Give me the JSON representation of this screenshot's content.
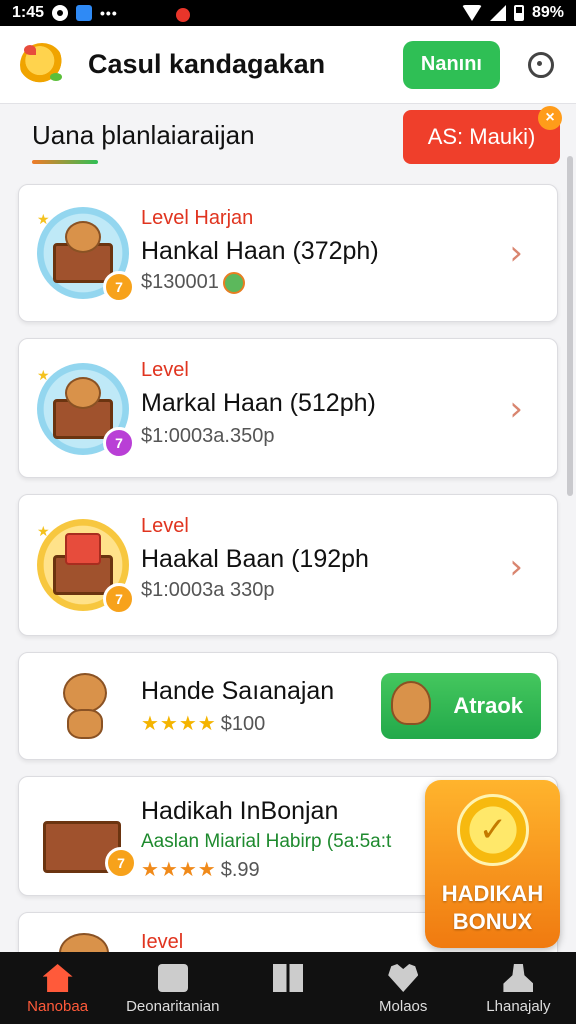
{
  "status_bar": {
    "time": "1:45",
    "battery": "89%"
  },
  "header": {
    "title": "Casul kandagakan",
    "primary_button": "Nanını"
  },
  "section": {
    "title": "Uana þlanlaiaraijan",
    "promo_button": "AS: Mauki)",
    "promo_close": "×"
  },
  "cards": [
    {
      "level": "Level Harjan",
      "title": "Hankal Haan (372ph)",
      "price": "$130001",
      "badge": "7"
    },
    {
      "level": "Level",
      "title": "Markal Haan (512ph)",
      "price": "$1:0003a.350p",
      "badge": "7"
    },
    {
      "level": "Level",
      "title": "Haakal Baan (192ph",
      "price": "$1:0003a 330p",
      "badge": "7"
    }
  ],
  "featured": {
    "title": "Hande Saıanajan",
    "stars": "★★★★",
    "price": "$100",
    "button": "Atraok"
  },
  "bundle": {
    "title": "Hadikah InBonjan",
    "subtitle": "Aaslan Miarial Habirp (5a:5a:t",
    "stars": "★★★★",
    "price": "$.99",
    "badge": "7"
  },
  "partial_card": {
    "level": "Ievel"
  },
  "bonus": {
    "line1": "HADIKAH",
    "line2": "BONUX"
  },
  "bottom_nav": [
    {
      "label": "Nanobaa",
      "icon": "home-icon"
    },
    {
      "label": "Deonaritanian",
      "icon": "chat-icon"
    },
    {
      "label": "",
      "icon": "cards-icon"
    },
    {
      "label": "Molaos",
      "icon": "heart-icon"
    },
    {
      "label": "Lhanajaly",
      "icon": "profile-icon"
    }
  ],
  "colors": {
    "accent_green": "#2fbf55",
    "accent_red": "#ef3f2b",
    "accent_orange": "#f07a10",
    "nav_active": "#ff5a3a"
  }
}
